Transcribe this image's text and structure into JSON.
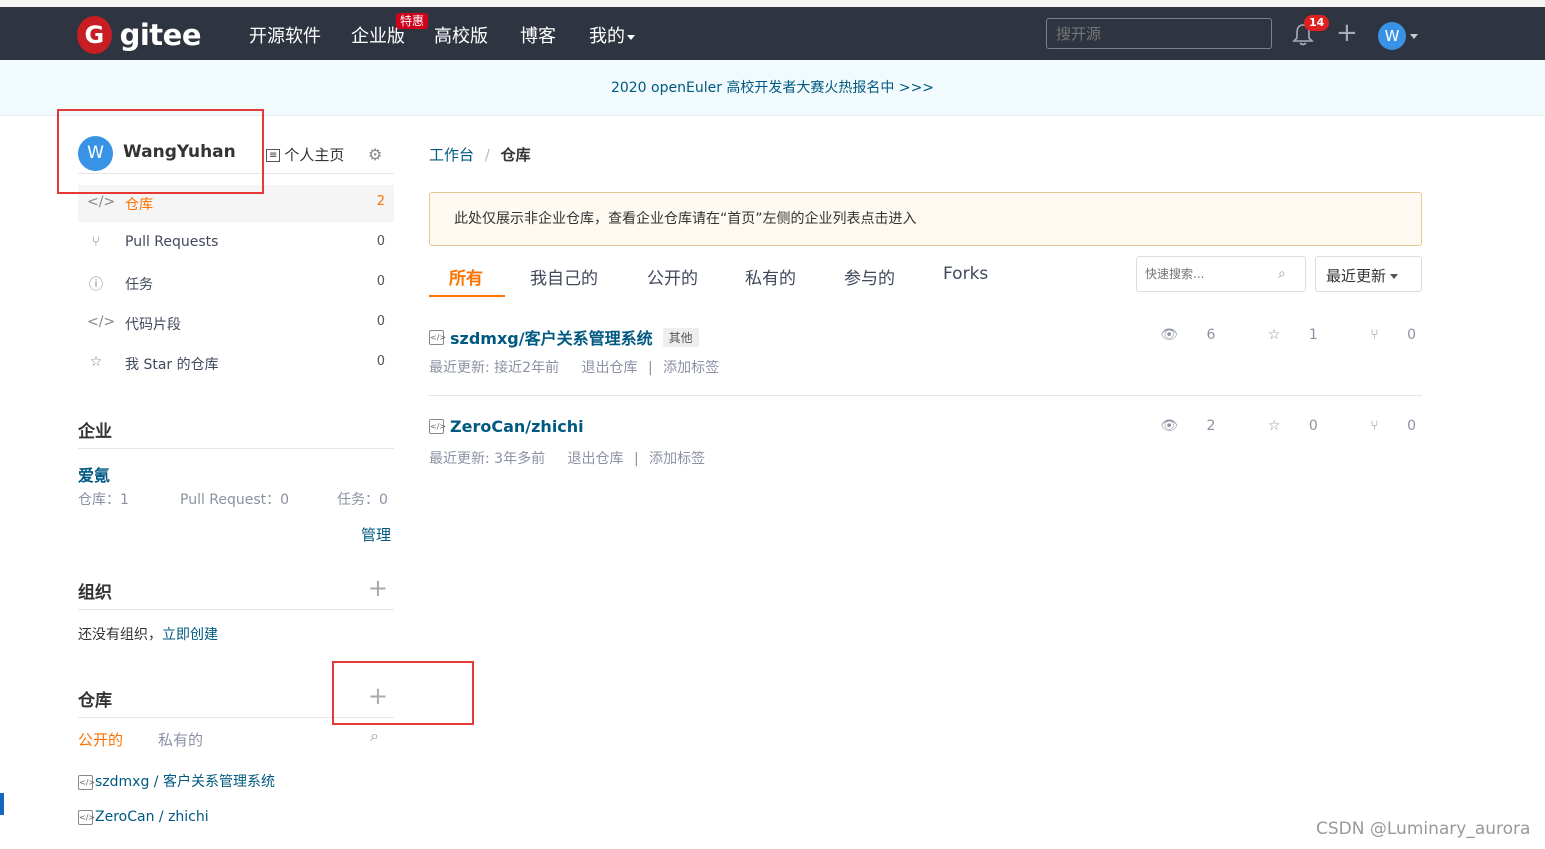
{
  "navbar": {
    "logo_mark": "G",
    "logo_text": "gitee",
    "items": [
      "开源软件",
      "企业版",
      "高校版",
      "博客",
      "我的"
    ],
    "enterprise_badge": "特惠",
    "search_placeholder": "搜开源",
    "notification_count": "14",
    "avatar_letter": "W"
  },
  "banner": {
    "text": "2020 openEuler 高校开发者大赛火热报名中 >>>"
  },
  "profile": {
    "avatar_letter": "W",
    "username": "WangYuhan",
    "home_link": "个人主页"
  },
  "menu": [
    {
      "label": "仓库",
      "count": "2",
      "icon": "repo-icon"
    },
    {
      "label": "Pull Requests",
      "count": "0",
      "icon": "pull-request-icon"
    },
    {
      "label": "任务",
      "count": "0",
      "icon": "issue-icon"
    },
    {
      "label": "代码片段",
      "count": "0",
      "icon": "code-snippet-icon"
    },
    {
      "label": "我 Star 的仓库",
      "count": "0",
      "icon": "star-icon"
    }
  ],
  "enterprise": {
    "title": "企业",
    "name": "爱氪",
    "repos": "仓库：1",
    "prs": "Pull Request：0",
    "tasks": "任务：0",
    "manage": "管理"
  },
  "orgs": {
    "title": "组织",
    "empty_text": "还没有组织，",
    "create_link": "立即创建"
  },
  "repo_section": {
    "title": "仓库",
    "tab_public": "公开的",
    "tab_private": "私有的",
    "items": [
      "szdmxg / 客户关系管理系统",
      "ZeroCan / zhichi"
    ]
  },
  "breadcrumb": {
    "root": "工作台",
    "sep": "/",
    "current": "仓库"
  },
  "notice": {
    "text": "此处仅展示非企业仓库，查看企业仓库请在“首页”左侧的企业列表点击进入"
  },
  "tabs": [
    "所有",
    "我自己的",
    "公开的",
    "私有的",
    "参与的",
    "Forks"
  ],
  "quick_search_placeholder": "快速搜索...",
  "sort_label": "最近更新",
  "repos": [
    {
      "name": "szdmxg/客户关系管理系统",
      "tag": "其他",
      "updated": "最近更新: 接近2年前",
      "exit": "退出仓库",
      "sep": "|",
      "add_tag": "添加标签",
      "watch": "6",
      "star": "1",
      "fork": "0"
    },
    {
      "name": "ZeroCan/zhichi",
      "tag": "",
      "updated": "最近更新: 3年多前",
      "exit": "退出仓库",
      "sep": "|",
      "add_tag": "添加标签",
      "watch": "2",
      "star": "0",
      "fork": "0"
    }
  ],
  "watermark": "CSDN @Luminary_aurora",
  "colors": {
    "accent": "#fe7300",
    "link": "#005980",
    "navbar": "#2e3440",
    "highlight_box": "#e53935"
  }
}
